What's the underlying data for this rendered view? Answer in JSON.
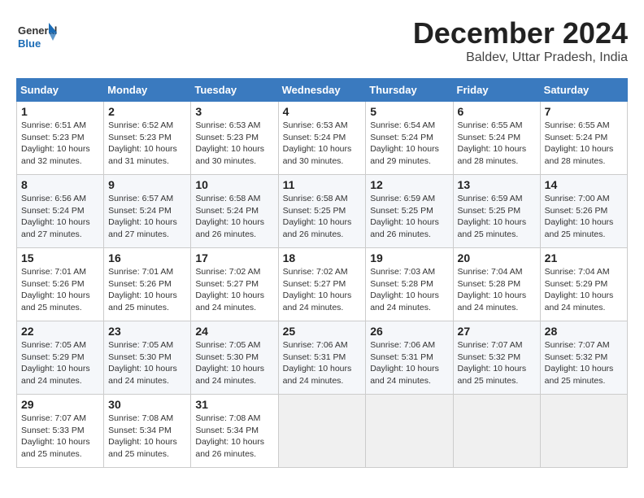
{
  "logo": {
    "general": "General",
    "blue": "Blue"
  },
  "title": {
    "month": "December 2024",
    "location": "Baldev, Uttar Pradesh, India"
  },
  "weekdays": [
    "Sunday",
    "Monday",
    "Tuesday",
    "Wednesday",
    "Thursday",
    "Friday",
    "Saturday"
  ],
  "weeks": [
    [
      {
        "day": "1",
        "sunrise": "6:51 AM",
        "sunset": "5:23 PM",
        "daylight": "10 hours and 32 minutes."
      },
      {
        "day": "2",
        "sunrise": "6:52 AM",
        "sunset": "5:23 PM",
        "daylight": "10 hours and 31 minutes."
      },
      {
        "day": "3",
        "sunrise": "6:53 AM",
        "sunset": "5:23 PM",
        "daylight": "10 hours and 30 minutes."
      },
      {
        "day": "4",
        "sunrise": "6:53 AM",
        "sunset": "5:24 PM",
        "daylight": "10 hours and 30 minutes."
      },
      {
        "day": "5",
        "sunrise": "6:54 AM",
        "sunset": "5:24 PM",
        "daylight": "10 hours and 29 minutes."
      },
      {
        "day": "6",
        "sunrise": "6:55 AM",
        "sunset": "5:24 PM",
        "daylight": "10 hours and 28 minutes."
      },
      {
        "day": "7",
        "sunrise": "6:55 AM",
        "sunset": "5:24 PM",
        "daylight": "10 hours and 28 minutes."
      }
    ],
    [
      {
        "day": "8",
        "sunrise": "6:56 AM",
        "sunset": "5:24 PM",
        "daylight": "10 hours and 27 minutes."
      },
      {
        "day": "9",
        "sunrise": "6:57 AM",
        "sunset": "5:24 PM",
        "daylight": "10 hours and 27 minutes."
      },
      {
        "day": "10",
        "sunrise": "6:58 AM",
        "sunset": "5:24 PM",
        "daylight": "10 hours and 26 minutes."
      },
      {
        "day": "11",
        "sunrise": "6:58 AM",
        "sunset": "5:25 PM",
        "daylight": "10 hours and 26 minutes."
      },
      {
        "day": "12",
        "sunrise": "6:59 AM",
        "sunset": "5:25 PM",
        "daylight": "10 hours and 26 minutes."
      },
      {
        "day": "13",
        "sunrise": "6:59 AM",
        "sunset": "5:25 PM",
        "daylight": "10 hours and 25 minutes."
      },
      {
        "day": "14",
        "sunrise": "7:00 AM",
        "sunset": "5:26 PM",
        "daylight": "10 hours and 25 minutes."
      }
    ],
    [
      {
        "day": "15",
        "sunrise": "7:01 AM",
        "sunset": "5:26 PM",
        "daylight": "10 hours and 25 minutes."
      },
      {
        "day": "16",
        "sunrise": "7:01 AM",
        "sunset": "5:26 PM",
        "daylight": "10 hours and 25 minutes."
      },
      {
        "day": "17",
        "sunrise": "7:02 AM",
        "sunset": "5:27 PM",
        "daylight": "10 hours and 24 minutes."
      },
      {
        "day": "18",
        "sunrise": "7:02 AM",
        "sunset": "5:27 PM",
        "daylight": "10 hours and 24 minutes."
      },
      {
        "day": "19",
        "sunrise": "7:03 AM",
        "sunset": "5:28 PM",
        "daylight": "10 hours and 24 minutes."
      },
      {
        "day": "20",
        "sunrise": "7:04 AM",
        "sunset": "5:28 PM",
        "daylight": "10 hours and 24 minutes."
      },
      {
        "day": "21",
        "sunrise": "7:04 AM",
        "sunset": "5:29 PM",
        "daylight": "10 hours and 24 minutes."
      }
    ],
    [
      {
        "day": "22",
        "sunrise": "7:05 AM",
        "sunset": "5:29 PM",
        "daylight": "10 hours and 24 minutes."
      },
      {
        "day": "23",
        "sunrise": "7:05 AM",
        "sunset": "5:30 PM",
        "daylight": "10 hours and 24 minutes."
      },
      {
        "day": "24",
        "sunrise": "7:05 AM",
        "sunset": "5:30 PM",
        "daylight": "10 hours and 24 minutes."
      },
      {
        "day": "25",
        "sunrise": "7:06 AM",
        "sunset": "5:31 PM",
        "daylight": "10 hours and 24 minutes."
      },
      {
        "day": "26",
        "sunrise": "7:06 AM",
        "sunset": "5:31 PM",
        "daylight": "10 hours and 24 minutes."
      },
      {
        "day": "27",
        "sunrise": "7:07 AM",
        "sunset": "5:32 PM",
        "daylight": "10 hours and 25 minutes."
      },
      {
        "day": "28",
        "sunrise": "7:07 AM",
        "sunset": "5:32 PM",
        "daylight": "10 hours and 25 minutes."
      }
    ],
    [
      {
        "day": "29",
        "sunrise": "7:07 AM",
        "sunset": "5:33 PM",
        "daylight": "10 hours and 25 minutes."
      },
      {
        "day": "30",
        "sunrise": "7:08 AM",
        "sunset": "5:34 PM",
        "daylight": "10 hours and 25 minutes."
      },
      {
        "day": "31",
        "sunrise": "7:08 AM",
        "sunset": "5:34 PM",
        "daylight": "10 hours and 26 minutes."
      },
      null,
      null,
      null,
      null
    ]
  ]
}
